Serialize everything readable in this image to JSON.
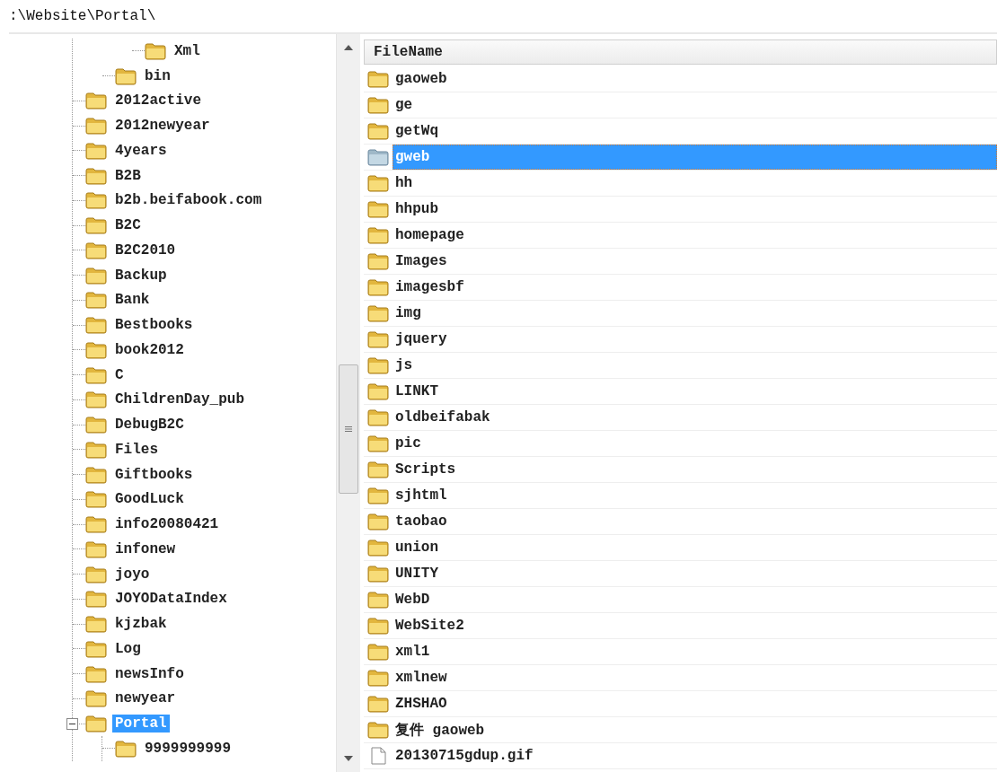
{
  "path_bar": {
    "text": ":\\Website\\Portal\\"
  },
  "tree": {
    "items": [
      {
        "children": [
          {
            "children": [
              {
                "label": "Xml",
                "selected": false
              }
            ]
          },
          {
            "label": "bin",
            "selected": false
          }
        ]
      },
      {
        "label": "2012active",
        "selected": false
      },
      {
        "label": "2012newyear",
        "selected": false
      },
      {
        "label": "4years",
        "selected": false
      },
      {
        "label": "B2B",
        "selected": false
      },
      {
        "label": "b2b.beifabook.com",
        "selected": false
      },
      {
        "label": "B2C",
        "selected": false
      },
      {
        "label": "B2C2010",
        "selected": false
      },
      {
        "label": "Backup",
        "selected": false
      },
      {
        "label": "Bank",
        "selected": false
      },
      {
        "label": "Bestbooks",
        "selected": false
      },
      {
        "label": "book2012",
        "selected": false
      },
      {
        "label": "C",
        "selected": false
      },
      {
        "label": "ChildrenDay_pub",
        "selected": false
      },
      {
        "label": "DebugB2C",
        "selected": false
      },
      {
        "label": "Files",
        "selected": false
      },
      {
        "label": "Giftbooks",
        "selected": false
      },
      {
        "label": "GoodLuck",
        "selected": false
      },
      {
        "label": "info20080421",
        "selected": false
      },
      {
        "label": "infonew",
        "selected": false
      },
      {
        "label": "joyo",
        "selected": false
      },
      {
        "label": "JOYODataIndex",
        "selected": false
      },
      {
        "label": "kjzbak",
        "selected": false
      },
      {
        "label": "Log",
        "selected": false
      },
      {
        "label": "newsInfo",
        "selected": false
      },
      {
        "label": "newyear",
        "selected": false
      },
      {
        "label": "Portal",
        "selected": true,
        "expanded": true,
        "children": [
          {
            "label": "9999999999",
            "selected": false
          }
        ]
      }
    ]
  },
  "file_list": {
    "columns": [
      "FileName"
    ],
    "rows": [
      {
        "name": "gaoweb",
        "kind": "folder",
        "selected": false
      },
      {
        "name": "ge",
        "kind": "folder",
        "selected": false
      },
      {
        "name": "getWq",
        "kind": "folder",
        "selected": false
      },
      {
        "name": "gweb",
        "kind": "folder",
        "selected": true
      },
      {
        "name": "hh",
        "kind": "folder",
        "selected": false
      },
      {
        "name": "hhpub",
        "kind": "folder",
        "selected": false
      },
      {
        "name": "homepage",
        "kind": "folder",
        "selected": false
      },
      {
        "name": "Images",
        "kind": "folder",
        "selected": false
      },
      {
        "name": "imagesbf",
        "kind": "folder",
        "selected": false
      },
      {
        "name": "img",
        "kind": "folder",
        "selected": false
      },
      {
        "name": "jquery",
        "kind": "folder",
        "selected": false
      },
      {
        "name": "js",
        "kind": "folder",
        "selected": false
      },
      {
        "name": "LINKT",
        "kind": "folder",
        "selected": false
      },
      {
        "name": "oldbeifabak",
        "kind": "folder",
        "selected": false
      },
      {
        "name": "pic",
        "kind": "folder",
        "selected": false
      },
      {
        "name": "Scripts",
        "kind": "folder",
        "selected": false
      },
      {
        "name": "sjhtml",
        "kind": "folder",
        "selected": false
      },
      {
        "name": "taobao",
        "kind": "folder",
        "selected": false
      },
      {
        "name": "union",
        "kind": "folder",
        "selected": false
      },
      {
        "name": "UNITY",
        "kind": "folder",
        "selected": false
      },
      {
        "name": "WebD",
        "kind": "folder",
        "selected": false
      },
      {
        "name": "WebSite2",
        "kind": "folder",
        "selected": false
      },
      {
        "name": "xml1",
        "kind": "folder",
        "selected": false
      },
      {
        "name": "xmlnew",
        "kind": "folder",
        "selected": false
      },
      {
        "name": "ZHSHAO",
        "kind": "folder",
        "selected": false
      },
      {
        "name": "复件 gaoweb",
        "kind": "folder",
        "selected": false
      },
      {
        "name": "20130715gdup.gif",
        "kind": "file",
        "selected": false
      }
    ]
  }
}
